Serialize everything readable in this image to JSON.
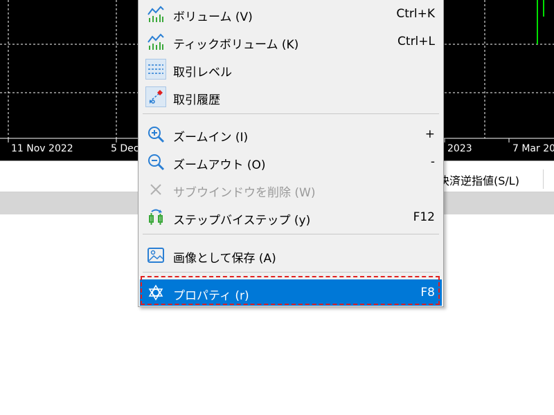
{
  "chart": {
    "date_labels": [
      "11 Nov 2022",
      "5 Dec",
      "2023",
      "7 Mar 20"
    ],
    "background_color": "#000000",
    "grid_color": "#ffffff"
  },
  "table_header": {
    "sl_column": "決済逆指値(S/L)"
  },
  "menu": {
    "items": [
      {
        "label": "ボリューム (V)",
        "shortcut": "Ctrl+K",
        "icon": "volume-chart-icon",
        "enabled": true
      },
      {
        "label": "ティックボリューム (K)",
        "shortcut": "Ctrl+L",
        "icon": "tick-volume-chart-icon",
        "enabled": true
      },
      {
        "label": "取引レベル",
        "shortcut": "",
        "icon": "trade-levels-icon",
        "enabled": true
      },
      {
        "label": "取引履歴",
        "shortcut": "",
        "icon": "trade-history-icon",
        "enabled": true
      },
      {
        "label": "ズームイン (I)",
        "shortcut": "+",
        "icon": "zoom-in-icon",
        "enabled": true
      },
      {
        "label": "ズームアウト (O)",
        "shortcut": "-",
        "icon": "zoom-out-icon",
        "enabled": true
      },
      {
        "label": "サブウインドウを削除 (W)",
        "shortcut": "",
        "icon": "delete-icon",
        "enabled": false
      },
      {
        "label": "ステップバイステップ (y)",
        "shortcut": "F12",
        "icon": "step-by-step-icon",
        "enabled": true
      },
      {
        "label": "画像として保存 (A)",
        "shortcut": "",
        "icon": "save-image-icon",
        "enabled": true
      },
      {
        "label": "プロパティ (r)",
        "shortcut": "F8",
        "icon": "gear-icon",
        "enabled": true,
        "selected": true
      }
    ],
    "selected_color": "#0078d7",
    "highlight_frame_color": "#e02020"
  }
}
